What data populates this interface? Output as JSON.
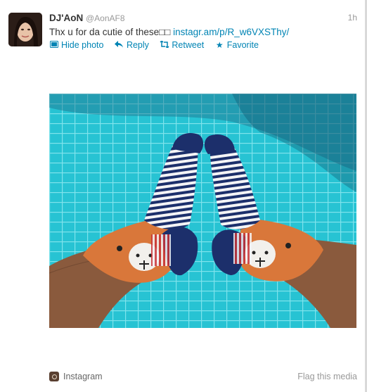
{
  "tweet": {
    "display_name": "DJ'AoN",
    "handle": "@AonAF8",
    "time": "1h",
    "text": "Thx u for da cutie of these□□ ",
    "link": "instagr.am/p/R_w6VXSThy/"
  },
  "actions": [
    {
      "label": "Hide photo",
      "icon": "photo-icon"
    },
    {
      "label": "Reply",
      "icon": "reply-icon"
    },
    {
      "label": "Retweet",
      "icon": "retweet-icon"
    },
    {
      "label": "Favorite",
      "icon": "star-icon"
    }
  ],
  "media": {
    "description_icon": "photo-socks-pool",
    "source": "Instagram",
    "flag_label": "Flag this media"
  },
  "colors": {
    "link": "#0084b4",
    "pool": "#2ec4d4",
    "sock_navy": "#1c2f6b",
    "sock_orange": "#d9773a"
  }
}
